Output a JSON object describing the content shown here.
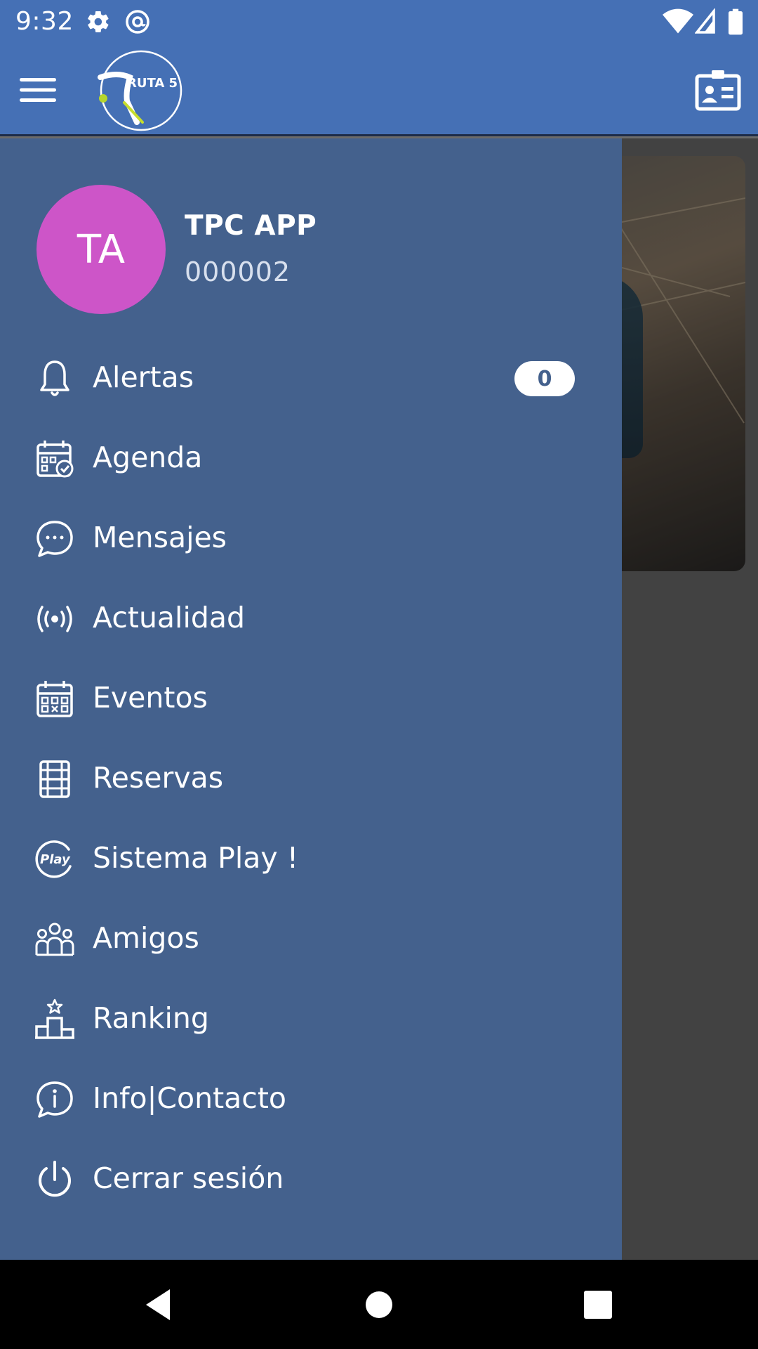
{
  "status_bar": {
    "time": "9:32",
    "icons_left": [
      "gear-icon",
      "at-sign-icon"
    ],
    "icons_right": [
      "wifi-icon",
      "cell-signal-icon",
      "battery-icon"
    ]
  },
  "app_bar": {
    "logo_text": "RUTA 5",
    "menu_icon": "hamburger-icon",
    "profile_card_icon": "id-card-icon"
  },
  "drawer": {
    "user": {
      "initials": "TA",
      "name": "TPC APP",
      "id": "000002"
    },
    "items": [
      {
        "label": "Alertas",
        "icon": "bell-icon",
        "badge": "0"
      },
      {
        "label": "Agenda",
        "icon": "calendar-check-icon"
      },
      {
        "label": "Mensajes",
        "icon": "chat-bubble-icon"
      },
      {
        "label": "Actualidad",
        "icon": "broadcast-icon"
      },
      {
        "label": "Eventos",
        "icon": "calendar-grid-icon"
      },
      {
        "label": "Reservas",
        "icon": "court-icon"
      },
      {
        "label": "Sistema Play !",
        "icon": "play-logo-icon"
      },
      {
        "label": "Amigos",
        "icon": "group-icon"
      },
      {
        "label": "Ranking",
        "icon": "podium-icon"
      },
      {
        "label": "Info|Contacto",
        "icon": "info-bubble-icon"
      },
      {
        "label": "Cerrar sesión",
        "icon": "power-icon"
      }
    ]
  },
  "colors": {
    "status_bar": "#4570b5",
    "app_bar": "#4570b5",
    "drawer": "#44618d",
    "avatar": "#cd55c8",
    "badge_bg": "#ffffff"
  },
  "nav_bar": {
    "buttons": [
      "back-icon",
      "home-icon",
      "recents-icon"
    ]
  }
}
